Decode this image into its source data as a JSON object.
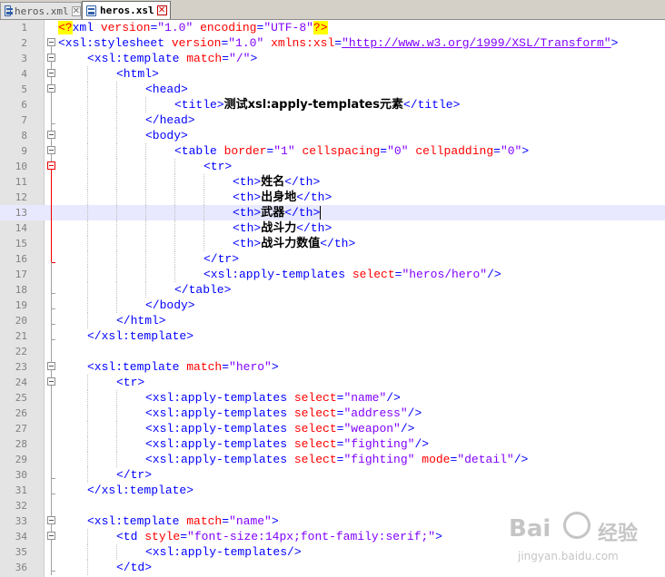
{
  "tabs": [
    {
      "label": "heros.xml",
      "active": false
    },
    {
      "label": "heros.xsl",
      "active": true
    }
  ],
  "icons": {
    "file": "file-save-icon",
    "close": "close-tab-icon",
    "fold": "fold-minus-icon"
  },
  "colors": {
    "tag": "#0000ff",
    "attribute": "#ff0000",
    "value": "#8000ff",
    "line_number": "#808080",
    "current_line": "#e8e8ff"
  },
  "editor": {
    "current_line": 13,
    "lines": [
      {
        "n": "1",
        "indent": 0,
        "fold": "none",
        "tokens": [
          [
            "pi",
            "<?"
          ],
          [
            "tag",
            "xml "
          ],
          [
            "attr",
            "version"
          ],
          [
            "tag",
            "="
          ],
          [
            "val",
            "\"1.0\""
          ],
          [
            "tag",
            " "
          ],
          [
            "attr",
            "encoding"
          ],
          [
            "tag",
            "="
          ],
          [
            "val",
            "\"UTF-8\""
          ],
          [
            "pi",
            "?>"
          ]
        ]
      },
      {
        "n": "2",
        "indent": 0,
        "fold": "open",
        "tokens": [
          [
            "tag",
            "<xsl:stylesheet "
          ],
          [
            "attr",
            "version"
          ],
          [
            "tag",
            "="
          ],
          [
            "val",
            "\"1.0\""
          ],
          [
            "tag",
            " "
          ],
          [
            "attr",
            "xmlns:xsl"
          ],
          [
            "tag",
            "="
          ],
          [
            "url",
            "\"http://www.w3.org/1999/XSL/Transform\""
          ],
          [
            "tag",
            ">"
          ]
        ]
      },
      {
        "n": "3",
        "indent": 1,
        "fold": "open",
        "tokens": [
          [
            "tag",
            "<xsl:template "
          ],
          [
            "attr",
            "match"
          ],
          [
            "tag",
            "="
          ],
          [
            "val",
            "\"/\""
          ],
          [
            "tag",
            ">"
          ]
        ]
      },
      {
        "n": "4",
        "indent": 2,
        "fold": "open",
        "tokens": [
          [
            "tag",
            "<html>"
          ]
        ]
      },
      {
        "n": "5",
        "indent": 3,
        "fold": "open",
        "tokens": [
          [
            "tag",
            "<head>"
          ]
        ]
      },
      {
        "n": "6",
        "indent": 4,
        "fold": "line",
        "tokens": [
          [
            "tag",
            "<title>"
          ],
          [
            "text",
            "测试xsl:apply-templates元素"
          ],
          [
            "tag",
            "</title>"
          ]
        ]
      },
      {
        "n": "7",
        "indent": 3,
        "fold": "end",
        "tokens": [
          [
            "tag",
            "</head>"
          ]
        ]
      },
      {
        "n": "8",
        "indent": 3,
        "fold": "open",
        "tokens": [
          [
            "tag",
            "<body>"
          ]
        ]
      },
      {
        "n": "9",
        "indent": 4,
        "fold": "open",
        "tokens": [
          [
            "tag",
            "<table "
          ],
          [
            "attr",
            "border"
          ],
          [
            "tag",
            "="
          ],
          [
            "val",
            "\"1\""
          ],
          [
            "tag",
            " "
          ],
          [
            "attr",
            "cellspacing"
          ],
          [
            "tag",
            "="
          ],
          [
            "val",
            "\"0\""
          ],
          [
            "tag",
            " "
          ],
          [
            "attr",
            "cellpadding"
          ],
          [
            "tag",
            "="
          ],
          [
            "val",
            "\"0\""
          ],
          [
            "tag",
            ">"
          ]
        ]
      },
      {
        "n": "10",
        "indent": 5,
        "fold": "open-red",
        "tokens": [
          [
            "tag",
            "<tr>"
          ]
        ]
      },
      {
        "n": "11",
        "indent": 6,
        "fold": "line-red",
        "tokens": [
          [
            "tag",
            "<th>"
          ],
          [
            "text",
            "姓名"
          ],
          [
            "tag",
            "</th>"
          ]
        ]
      },
      {
        "n": "12",
        "indent": 6,
        "fold": "line-red",
        "tokens": [
          [
            "tag",
            "<th>"
          ],
          [
            "text",
            "出身地"
          ],
          [
            "tag",
            "</th>"
          ]
        ]
      },
      {
        "n": "13",
        "indent": 6,
        "fold": "line-red",
        "tokens": [
          [
            "tag",
            "<th>"
          ],
          [
            "text",
            "武器"
          ],
          [
            "tag",
            "</th>"
          ]
        ]
      },
      {
        "n": "14",
        "indent": 6,
        "fold": "line-red",
        "tokens": [
          [
            "tag",
            "<th>"
          ],
          [
            "text",
            "战斗力"
          ],
          [
            "tag",
            "</th>"
          ]
        ]
      },
      {
        "n": "15",
        "indent": 6,
        "fold": "line-red",
        "tokens": [
          [
            "tag",
            "<th>"
          ],
          [
            "text",
            "战斗力数值"
          ],
          [
            "tag",
            "</th>"
          ]
        ]
      },
      {
        "n": "16",
        "indent": 5,
        "fold": "end-red",
        "tokens": [
          [
            "tag",
            "</tr>"
          ]
        ]
      },
      {
        "n": "17",
        "indent": 5,
        "fold": "line",
        "tokens": [
          [
            "tag",
            "<xsl:apply-templates "
          ],
          [
            "attr",
            "select"
          ],
          [
            "tag",
            "="
          ],
          [
            "val",
            "\"heros/hero\""
          ],
          [
            "tag",
            "/>"
          ]
        ]
      },
      {
        "n": "18",
        "indent": 4,
        "fold": "end",
        "tokens": [
          [
            "tag",
            "</table>"
          ]
        ]
      },
      {
        "n": "19",
        "indent": 3,
        "fold": "end",
        "tokens": [
          [
            "tag",
            "</body>"
          ]
        ]
      },
      {
        "n": "20",
        "indent": 2,
        "fold": "end",
        "tokens": [
          [
            "tag",
            "</html>"
          ]
        ]
      },
      {
        "n": "21",
        "indent": 1,
        "fold": "end",
        "tokens": [
          [
            "tag",
            "</xsl:template>"
          ]
        ]
      },
      {
        "n": "22",
        "indent": 0,
        "fold": "line",
        "tokens": []
      },
      {
        "n": "23",
        "indent": 1,
        "fold": "open",
        "tokens": [
          [
            "tag",
            "<xsl:template "
          ],
          [
            "attr",
            "match"
          ],
          [
            "tag",
            "="
          ],
          [
            "val",
            "\"hero\""
          ],
          [
            "tag",
            ">"
          ]
        ]
      },
      {
        "n": "24",
        "indent": 2,
        "fold": "open",
        "tokens": [
          [
            "tag",
            "<tr>"
          ]
        ]
      },
      {
        "n": "25",
        "indent": 3,
        "fold": "line",
        "tokens": [
          [
            "tag",
            "<xsl:apply-templates "
          ],
          [
            "attr",
            "select"
          ],
          [
            "tag",
            "="
          ],
          [
            "val",
            "\"name\""
          ],
          [
            "tag",
            "/>"
          ]
        ]
      },
      {
        "n": "26",
        "indent": 3,
        "fold": "line",
        "tokens": [
          [
            "tag",
            "<xsl:apply-templates "
          ],
          [
            "attr",
            "select"
          ],
          [
            "tag",
            "="
          ],
          [
            "val",
            "\"address\""
          ],
          [
            "tag",
            "/>"
          ]
        ]
      },
      {
        "n": "27",
        "indent": 3,
        "fold": "line",
        "tokens": [
          [
            "tag",
            "<xsl:apply-templates "
          ],
          [
            "attr",
            "select"
          ],
          [
            "tag",
            "="
          ],
          [
            "val",
            "\"weapon\""
          ],
          [
            "tag",
            "/>"
          ]
        ]
      },
      {
        "n": "28",
        "indent": 3,
        "fold": "line",
        "tokens": [
          [
            "tag",
            "<xsl:apply-templates "
          ],
          [
            "attr",
            "select"
          ],
          [
            "tag",
            "="
          ],
          [
            "val",
            "\"fighting\""
          ],
          [
            "tag",
            "/>"
          ]
        ]
      },
      {
        "n": "29",
        "indent": 3,
        "fold": "line",
        "tokens": [
          [
            "tag",
            "<xsl:apply-templates "
          ],
          [
            "attr",
            "select"
          ],
          [
            "tag",
            "="
          ],
          [
            "val",
            "\"fighting\""
          ],
          [
            "tag",
            " "
          ],
          [
            "attr",
            "mode"
          ],
          [
            "tag",
            "="
          ],
          [
            "val",
            "\"detail\""
          ],
          [
            "tag",
            "/>"
          ]
        ]
      },
      {
        "n": "30",
        "indent": 2,
        "fold": "end",
        "tokens": [
          [
            "tag",
            "</tr>"
          ]
        ]
      },
      {
        "n": "31",
        "indent": 1,
        "fold": "end",
        "tokens": [
          [
            "tag",
            "</xsl:template>"
          ]
        ]
      },
      {
        "n": "32",
        "indent": 0,
        "fold": "line",
        "tokens": []
      },
      {
        "n": "33",
        "indent": 1,
        "fold": "open",
        "tokens": [
          [
            "tag",
            "<xsl:template "
          ],
          [
            "attr",
            "match"
          ],
          [
            "tag",
            "="
          ],
          [
            "val",
            "\"name\""
          ],
          [
            "tag",
            ">"
          ]
        ]
      },
      {
        "n": "34",
        "indent": 2,
        "fold": "open",
        "tokens": [
          [
            "tag",
            "<td "
          ],
          [
            "attr",
            "style"
          ],
          [
            "tag",
            "="
          ],
          [
            "val",
            "\"font-size:14px;font-family:serif;\""
          ],
          [
            "tag",
            ">"
          ]
        ]
      },
      {
        "n": "35",
        "indent": 3,
        "fold": "line",
        "tokens": [
          [
            "tag",
            "<xsl:apply-templates/>"
          ]
        ]
      },
      {
        "n": "36",
        "indent": 2,
        "fold": "end",
        "tokens": [
          [
            "tag",
            "</td>"
          ]
        ]
      }
    ]
  },
  "watermark": {
    "logo": "Bai",
    "brand": "经验",
    "url": "jingyan.baidu.com"
  }
}
